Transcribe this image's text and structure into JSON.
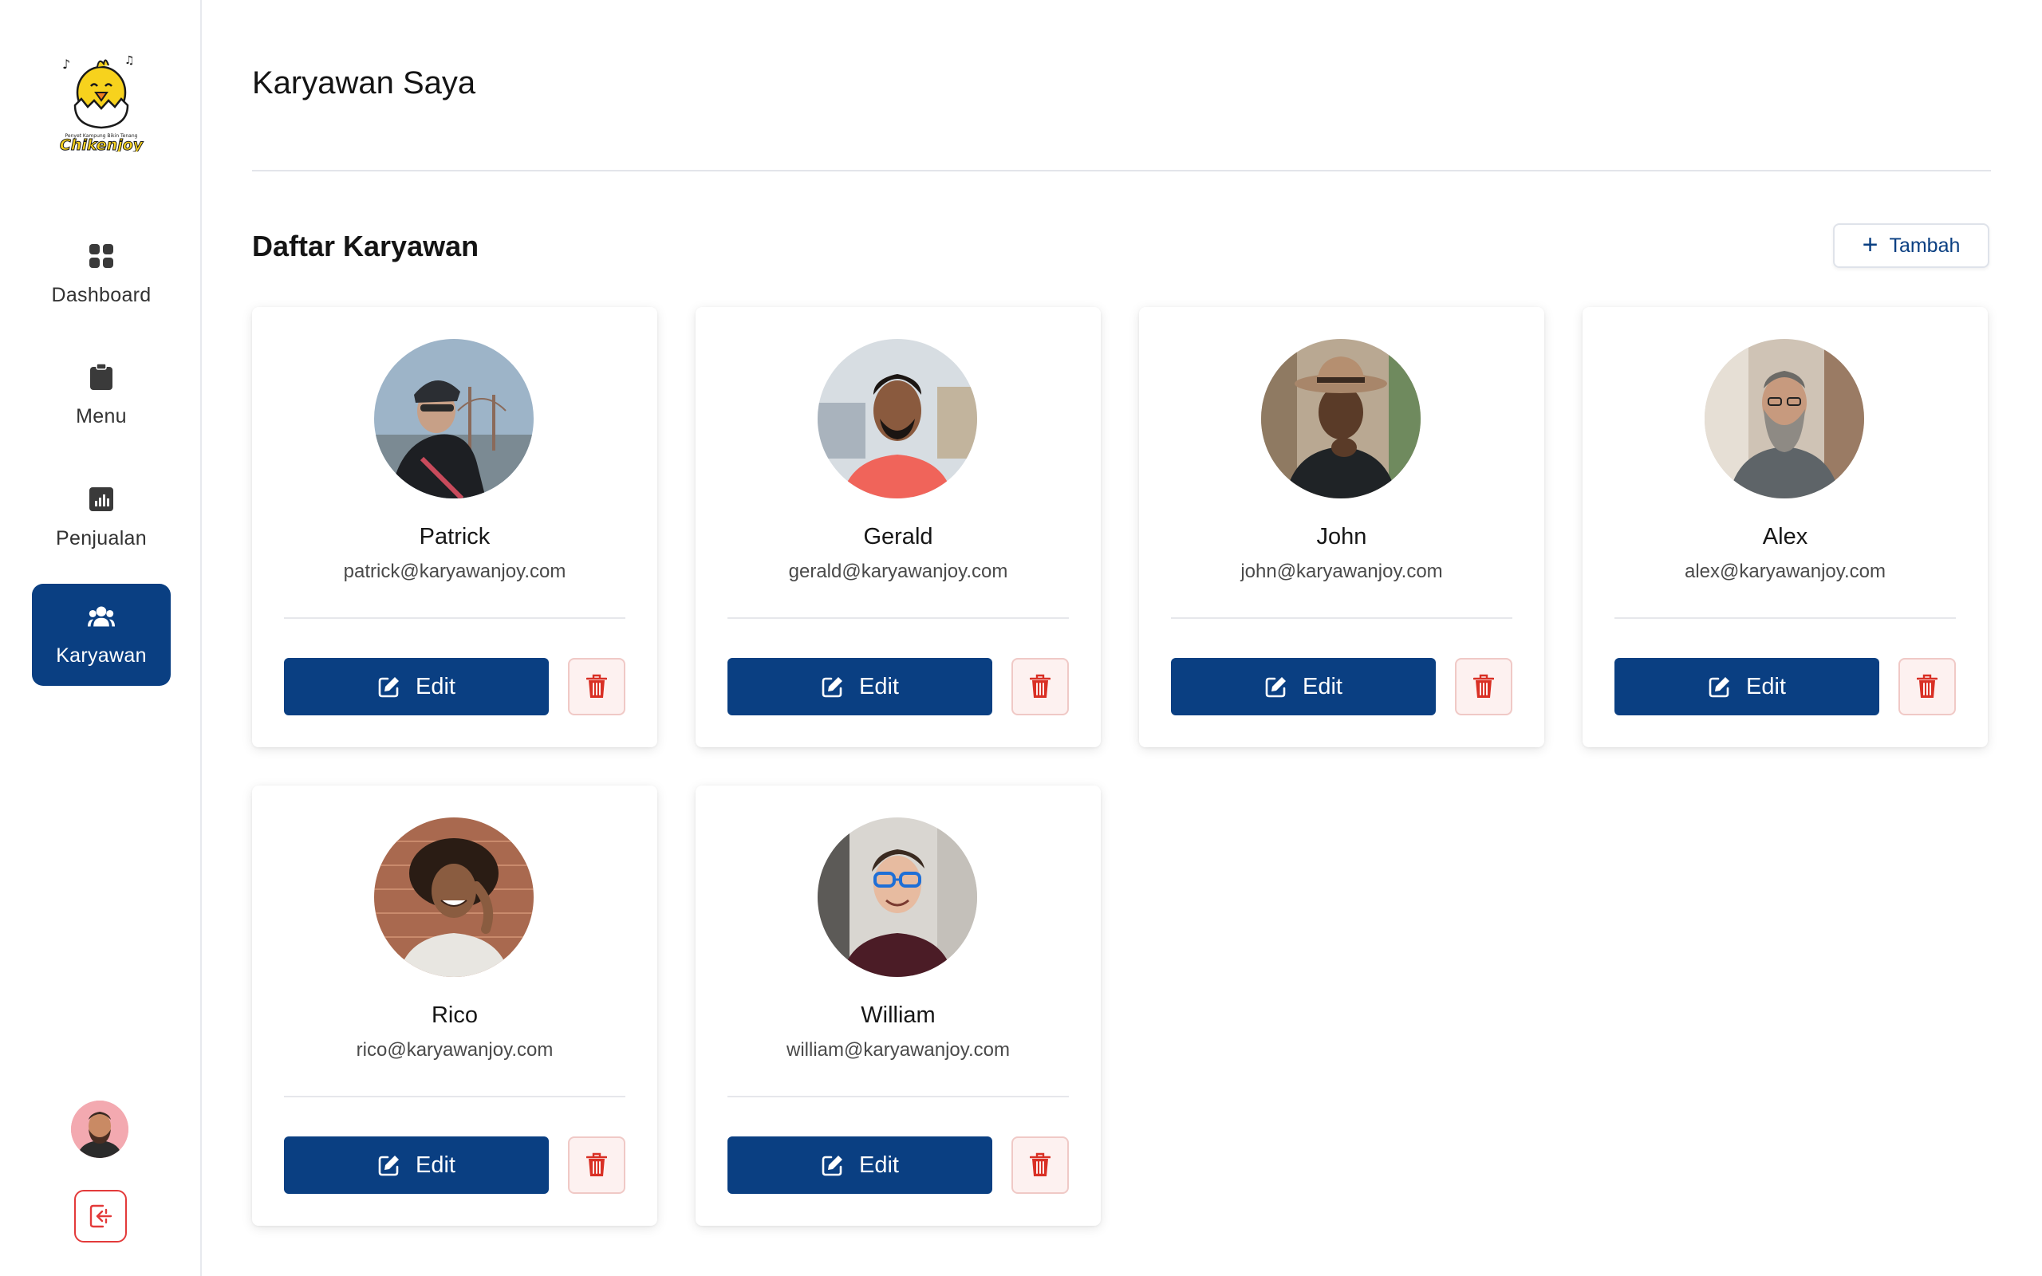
{
  "colors": {
    "primary": "#0a3f82",
    "danger": "#d93025",
    "sidebar_border": "#e7e9ee"
  },
  "sidebar": {
    "logo": {
      "tagline": "Penyet Kampung Bikin Tenang",
      "brand": "Chikenjoy"
    },
    "items": [
      {
        "label": "Dashboard",
        "icon": "dashboard-icon",
        "active": false
      },
      {
        "label": "Menu",
        "icon": "clipboard-icon",
        "active": false
      },
      {
        "label": "Penjualan",
        "icon": "chart-icon",
        "active": false
      },
      {
        "label": "Karyawan",
        "icon": "users-icon",
        "active": true
      }
    ],
    "user_icon": "user-avatar",
    "logout_icon": "logout-icon"
  },
  "header": {
    "title": "Karyawan Saya"
  },
  "section": {
    "title": "Daftar Karyawan",
    "add_label": "Tambah"
  },
  "employees": [
    {
      "name": "Patrick",
      "email": "patrick@karyawanjoy.com"
    },
    {
      "name": "Gerald",
      "email": "gerald@karyawanjoy.com"
    },
    {
      "name": "John",
      "email": "john@karyawanjoy.com"
    },
    {
      "name": "Alex",
      "email": "alex@karyawanjoy.com"
    },
    {
      "name": "Rico",
      "email": "rico@karyawanjoy.com"
    },
    {
      "name": "William",
      "email": "william@karyawanjoy.com"
    }
  ],
  "card_actions": {
    "edit_label": "Edit",
    "edit_icon": "edit-icon",
    "delete_icon": "trash-icon"
  }
}
